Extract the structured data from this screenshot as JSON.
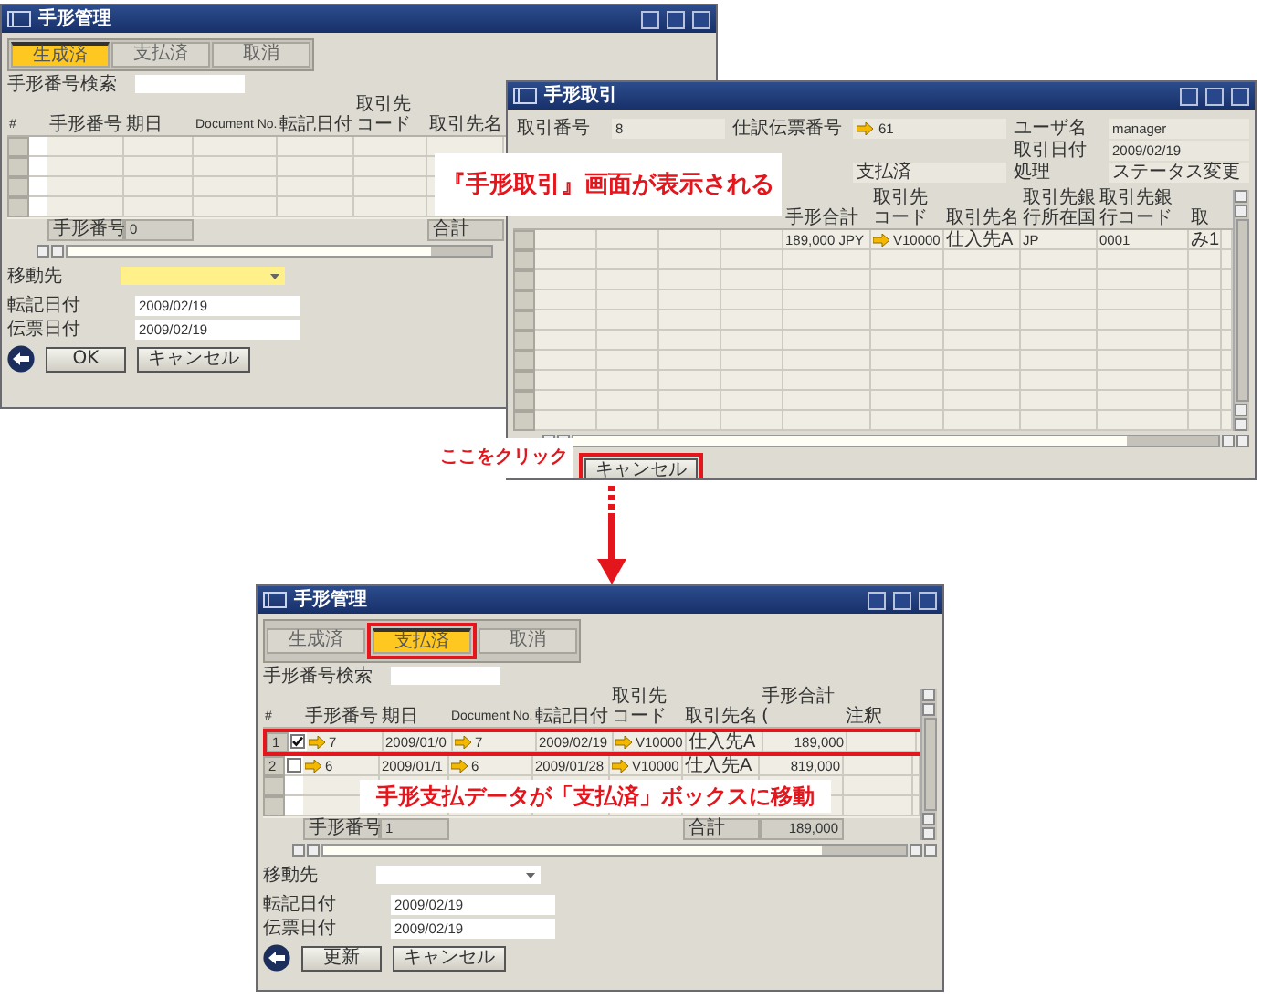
{
  "top_window": {
    "title": "手形管理",
    "tabs": [
      {
        "label": "生成済",
        "selected": true,
        "highlighted": false
      },
      {
        "label": "支払済",
        "selected": false,
        "highlighted": false
      },
      {
        "label": "取消",
        "selected": false,
        "highlighted": false
      }
    ],
    "search": {
      "label": "手形番号検索"
    },
    "columns": [
      {
        "kind": "number",
        "label": "#"
      },
      {
        "kind": "checkbox"
      },
      {
        "kind": "text",
        "label": "手形番号"
      },
      {
        "kind": "text",
        "label": "期日"
      },
      {
        "kind": "text",
        "label": "Document No."
      },
      {
        "kind": "text",
        "label": "転記日付"
      },
      {
        "kind": "text",
        "label": "取引先コード"
      },
      {
        "kind": "text",
        "label": "取引先名"
      }
    ],
    "footer": {
      "count_label": "手形番号",
      "count": "0",
      "total_label": "合計"
    },
    "move_to": {
      "label": "移動先",
      "focused": true
    },
    "dates": [
      {
        "label": "転記日付",
        "value": "2009/02/19"
      },
      {
        "label": "伝票日付",
        "value": "2009/02/19"
      }
    ],
    "buttons": [
      {
        "label": "OK",
        "highlighted": false
      },
      {
        "label": "キャンセル",
        "highlighted": false
      }
    ]
  },
  "detail_window": {
    "title": "手形取引",
    "fields": [
      {
        "label": "取引番号",
        "value": "8",
        "link": false
      },
      {
        "label": "仕訳伝票番号",
        "value": "61",
        "link": true
      },
      {
        "label": "ユーザ名",
        "value": "manager",
        "link": false
      },
      {
        "label": "取引日付",
        "value": "2009/02/19",
        "link": false
      },
      {
        "value": "支払済",
        "link": false
      },
      {
        "label": "処理",
        "value": "ステータス変更",
        "link": false
      }
    ],
    "columns": [
      "手形合計",
      "取引先コード",
      "取引先名",
      "取引先銀行所在国",
      "取引先銀行コード",
      "取"
    ],
    "rows": [
      {
        "cells": [
          {
            "text": "189,000 JPY",
            "link": false
          },
          {
            "text": "V10000",
            "link": true
          },
          {
            "text": "仕入先A",
            "link": false
          },
          {
            "text": "JP",
            "link": false
          },
          {
            "text": "0001",
            "link": false
          },
          {
            "text": "み1",
            "link": false
          }
        ]
      }
    ],
    "buttons": [
      {
        "label": "キャンセル",
        "highlighted": true
      }
    ]
  },
  "bottom_window": {
    "title": "手形管理",
    "tabs": [
      {
        "label": "生成済",
        "selected": false,
        "highlighted": false
      },
      {
        "label": "支払済",
        "selected": true,
        "highlighted": true
      },
      {
        "label": "取消",
        "selected": false,
        "highlighted": false
      }
    ],
    "search": {
      "label": "手形番号検索"
    },
    "columns": [
      {
        "kind": "number",
        "label": "#"
      },
      {
        "kind": "checkbox"
      },
      {
        "kind": "text",
        "label": "手形番号"
      },
      {
        "kind": "text",
        "label": "期日"
      },
      {
        "kind": "text",
        "label": "Document No."
      },
      {
        "kind": "text",
        "label": "転記日付"
      },
      {
        "kind": "text",
        "label": "取引先コード"
      },
      {
        "kind": "text",
        "label": "取引先名"
      },
      {
        "kind": "text",
        "label": "手形合計 ("
      },
      {
        "kind": "text",
        "label": "注釈"
      }
    ],
    "rows": [
      {
        "highlighted": true,
        "cells": [
          {
            "text": "1"
          },
          {
            "checked": true
          },
          {
            "text": "7",
            "link": true
          },
          {
            "text": "2009/01/0",
            "link": false
          },
          {
            "text": "7",
            "link": true
          },
          {
            "text": "2009/02/19",
            "link": false
          },
          {
            "text": "V10000",
            "link": true
          },
          {
            "text": "仕入先A",
            "link": false
          },
          {
            "text": "189,000",
            "link": false
          }
        ]
      },
      {
        "highlighted": false,
        "cells": [
          {
            "text": "2"
          },
          {
            "checked": false
          },
          {
            "text": "6",
            "link": true
          },
          {
            "text": "2009/01/1",
            "link": false
          },
          {
            "text": "6",
            "link": true
          },
          {
            "text": "2009/01/28",
            "link": false
          },
          {
            "text": "V10000",
            "link": true
          },
          {
            "text": "仕入先A",
            "link": false
          },
          {
            "text": "819,000",
            "link": false
          }
        ]
      }
    ],
    "footer": {
      "count_label": "手形番号",
      "count": "1",
      "total_label": "合計",
      "total": "189,000"
    },
    "move_to": {
      "label": "移動先",
      "focused": false
    },
    "dates": [
      {
        "label": "転記日付",
        "value": "2009/02/19"
      },
      {
        "label": "伝票日付",
        "value": "2009/02/19"
      }
    ],
    "buttons": [
      {
        "label": "更新",
        "highlighted": false
      },
      {
        "label": "キャンセル",
        "highlighted": false
      }
    ]
  },
  "annotations": [
    {
      "kind": "callout",
      "text": "『手形取引』画面が表示される"
    },
    {
      "kind": "note",
      "text": "ここをクリック"
    },
    {
      "kind": "arrow"
    },
    {
      "kind": "callout",
      "text": "手形支払データが「支払済」ボックスに移動"
    }
  ]
}
